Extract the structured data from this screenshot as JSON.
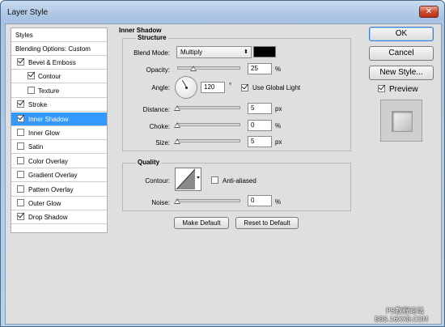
{
  "window": {
    "title": "Layer Style",
    "close_glyph": "✕"
  },
  "left_panel": {
    "header": "Styles",
    "blending": "Blending Options: Custom",
    "items": [
      {
        "label": "Bevel & Emboss",
        "checked": true,
        "indent": false
      },
      {
        "label": "Contour",
        "checked": true,
        "indent": true
      },
      {
        "label": "Texture",
        "checked": false,
        "indent": true
      },
      {
        "label": "Stroke",
        "checked": true,
        "indent": false
      },
      {
        "label": "Inner Shadow",
        "checked": true,
        "indent": false,
        "selected": true
      },
      {
        "label": "Inner Glow",
        "checked": false,
        "indent": false
      },
      {
        "label": "Satin",
        "checked": false,
        "indent": false
      },
      {
        "label": "Color Overlay",
        "checked": false,
        "indent": false
      },
      {
        "label": "Gradient Overlay",
        "checked": false,
        "indent": false
      },
      {
        "label": "Pattern Overlay",
        "checked": false,
        "indent": false
      },
      {
        "label": "Outer Glow",
        "checked": false,
        "indent": false
      },
      {
        "label": "Drop Shadow",
        "checked": true,
        "indent": false
      }
    ]
  },
  "inner_shadow": {
    "section_title": "Inner Shadow",
    "structure_title": "Structure",
    "blend_mode_label": "Blend Mode:",
    "blend_mode_value": "Multiply",
    "shadow_color": "#000000",
    "opacity_label": "Opacity:",
    "opacity_value": "25",
    "opacity_unit": "%",
    "opacity_fraction": 0.25,
    "angle_label": "Angle:",
    "angle_value": "120",
    "angle_unit": "°",
    "use_global_light_label": "Use Global Light",
    "use_global_light_checked": true,
    "distance_label": "Distance:",
    "distance_value": "5",
    "distance_unit": "px",
    "choke_label": "Choke:",
    "choke_value": "0",
    "choke_unit": "%",
    "size_label": "Size:",
    "size_value": "5",
    "size_unit": "px"
  },
  "quality": {
    "title": "Quality",
    "contour_label": "Contour:",
    "anti_aliased_label": "Anti-aliased",
    "anti_aliased_checked": false,
    "noise_label": "Noise:",
    "noise_value": "0",
    "noise_unit": "%"
  },
  "buttons": {
    "make_default": "Make Default",
    "reset_default": "Reset to Default",
    "ok": "OK",
    "cancel": "Cancel",
    "new_style": "New Style...",
    "preview_label": "Preview",
    "preview_checked": true
  },
  "watermark": {
    "line1": "PS教程论坛",
    "line2": "BBS.16XX8.COM"
  }
}
